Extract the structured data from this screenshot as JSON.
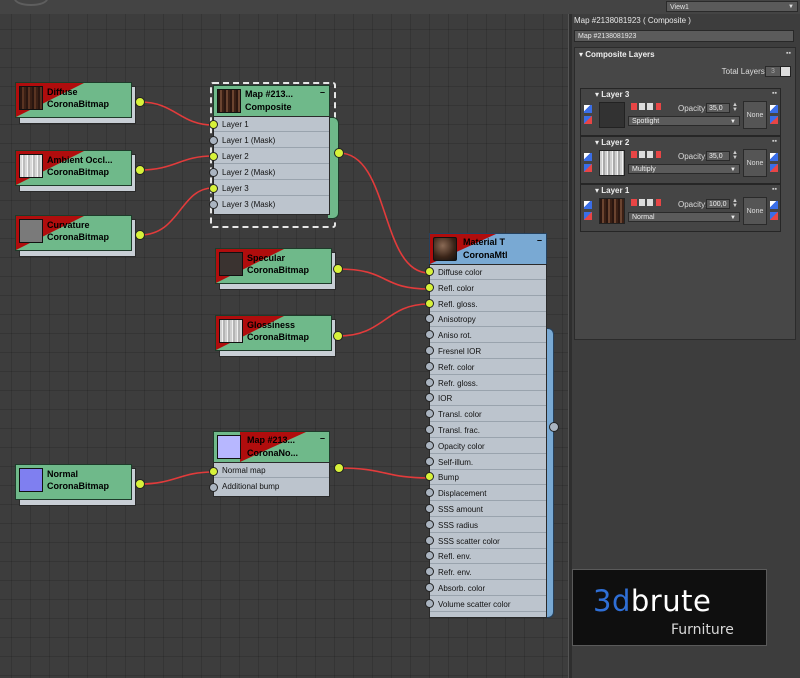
{
  "topbar": {
    "view_dropdown": "View1"
  },
  "nodes": {
    "diffuse": {
      "title1": "Diffuse",
      "title2": "CoronaBitmap"
    },
    "ambient": {
      "title1": "Ambient  Occl...",
      "title2": "CoronaBitmap"
    },
    "curvature": {
      "title1": "Curvature",
      "title2": "CoronaBitmap"
    },
    "composite": {
      "title1": "Map  #213...",
      "title2": "Composite",
      "slots": [
        "Layer 1",
        "Layer 1 (Mask)",
        "Layer 2",
        "Layer 2 (Mask)",
        "Layer 3",
        "Layer 3 (Mask)"
      ]
    },
    "specular": {
      "title1": "Specular",
      "title2": "CoronaBitmap"
    },
    "glossiness": {
      "title1": "Glossiness",
      "title2": "CoronaBitmap"
    },
    "normal": {
      "title1": "Normal",
      "title2": "CoronaBitmap"
    },
    "normalmap": {
      "title1": "Map #213...",
      "title2": "CoronaNo...",
      "slots": [
        "Normal map",
        "Additional bump"
      ]
    },
    "material": {
      "title1": "Material T",
      "title2": "CoronaMtl",
      "slots": [
        "Diffuse color",
        "Refl. color",
        "Refl. gloss.",
        "Anisotropy",
        "Aniso rot.",
        "Fresnel IOR",
        "Refr. color",
        "Refr. gloss.",
        "IOR",
        "Transl. color",
        "Transl. frac.",
        "Opacity color",
        "Self-illum.",
        "Bump",
        "Displacement",
        "SSS amount",
        "SSS radius",
        "SSS scatter color",
        "Refl. env.",
        "Refr. env.",
        "Absorb. color",
        "Volume scatter color"
      ]
    }
  },
  "panel": {
    "title": "Map #2138081923  ( Composite )",
    "name_field": "Map #2138081923",
    "rollout_title": "Composite Layers",
    "total_layers_label": "Total Layers:",
    "total_layers_value": "3",
    "opacity_label": "Opacity:",
    "none_label": "None",
    "layers": [
      {
        "name": "Layer 3",
        "opacity": "35,0",
        "blend": "Spotlight"
      },
      {
        "name": "Layer 2",
        "opacity": "35,0",
        "blend": "Multiply"
      },
      {
        "name": "Layer 1",
        "opacity": "100,0",
        "blend": "Normal"
      }
    ]
  },
  "watermark": {
    "brand_a": "3d",
    "brand_b": "brute",
    "sub": "Furniture"
  },
  "colors": {
    "node_green": "#6fb98a",
    "node_blue": "#79a9d3",
    "wire_red": "#e23b3b",
    "socket_active": "#d8f23a",
    "brand_blue": "#2f6fd6"
  }
}
